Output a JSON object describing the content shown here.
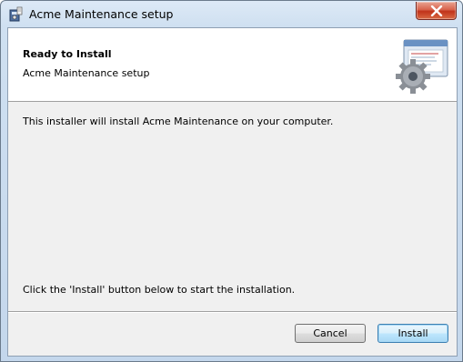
{
  "window": {
    "title": "Acme Maintenance setup",
    "app_icon": "installer-icon",
    "close_icon": "close-icon"
  },
  "banner": {
    "title": "Ready to Install",
    "subtitle": "Acme Maintenance setup",
    "graphic": "gear-window-icon"
  },
  "body": {
    "description": "This installer will install Acme Maintenance on your computer.",
    "instruction": "Click the 'Install' button below to start the installation."
  },
  "buttons": {
    "cancel_label": "Cancel",
    "install_label": "Install"
  },
  "colors": {
    "titlebar": "#cfe0f1",
    "close_button": "#c0331a",
    "dialog_background": "#f0f0f0",
    "banner_background": "#ffffff",
    "default_button_border": "#3c7fb1"
  }
}
